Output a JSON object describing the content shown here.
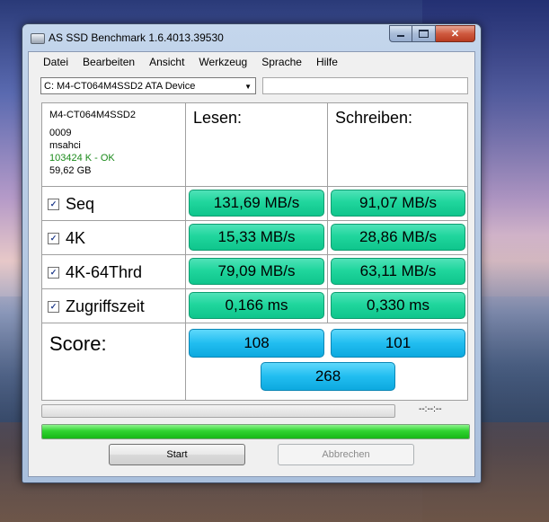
{
  "window": {
    "title": "AS SSD Benchmark 1.6.4013.39530"
  },
  "menu": [
    "Datei",
    "Bearbeiten",
    "Ansicht",
    "Werkzeug",
    "Sprache",
    "Hilfe"
  ],
  "drive": {
    "selected": "C: M4-CT064M4SSD2 ATA Device",
    "extra_field": ""
  },
  "info": {
    "model": "M4-CT064M4SSD2",
    "firmware": "0009",
    "driver": "msahci",
    "alignment": "103424 K - OK",
    "size": "59,62 GB"
  },
  "headers": {
    "read": "Lesen:",
    "write": "Schreiben:"
  },
  "rows": [
    {
      "label": "Seq",
      "checked": true,
      "read": "131,69 MB/s",
      "write": "91,07 MB/s"
    },
    {
      "label": "4K",
      "checked": true,
      "read": "15,33 MB/s",
      "write": "28,86 MB/s"
    },
    {
      "label": "4K-64Thrd",
      "checked": true,
      "read": "79,09 MB/s",
      "write": "63,11 MB/s"
    },
    {
      "label": "Zugriffszeit",
      "checked": true,
      "read": "0,166 ms",
      "write": "0,330 ms"
    }
  ],
  "score": {
    "label": "Score:",
    "read": "108",
    "write": "101",
    "total": "268"
  },
  "status": {
    "time": "--:--:--",
    "progress_complete": 1.0
  },
  "buttons": {
    "start": "Start",
    "cancel": "Abbrechen"
  },
  "colors": {
    "result_green": "#20d69d",
    "score_blue": "#21bdf0",
    "progress_green": "#2fd32f"
  }
}
